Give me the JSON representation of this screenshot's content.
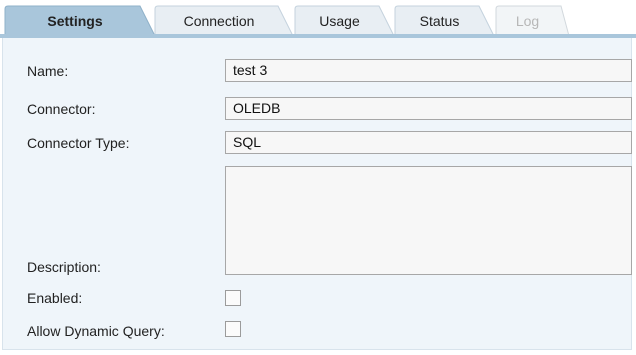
{
  "tabs": [
    {
      "label": "Settings",
      "state": "active"
    },
    {
      "label": "Connection",
      "state": "normal"
    },
    {
      "label": "Usage",
      "state": "normal"
    },
    {
      "label": "Status",
      "state": "normal"
    },
    {
      "label": "Log",
      "state": "disabled"
    }
  ],
  "form": {
    "name": {
      "label": "Name:",
      "value": "test 3"
    },
    "connector": {
      "label": "Connector:",
      "value": "OLEDB"
    },
    "connector_type": {
      "label": "Connector Type:",
      "value": "SQL"
    },
    "description": {
      "label": "Description:",
      "value": ""
    },
    "enabled": {
      "label": "Enabled:",
      "checked": false
    },
    "allow_dynamic_query": {
      "label": "Allow Dynamic Query:",
      "checked": false
    }
  },
  "colors": {
    "active_tab": "#a9c6db",
    "inactive_tab": "#e8eef3",
    "panel_background": "#eff5fa",
    "field_background": "#f7f7f7",
    "field_border": "#a7a7a7"
  }
}
